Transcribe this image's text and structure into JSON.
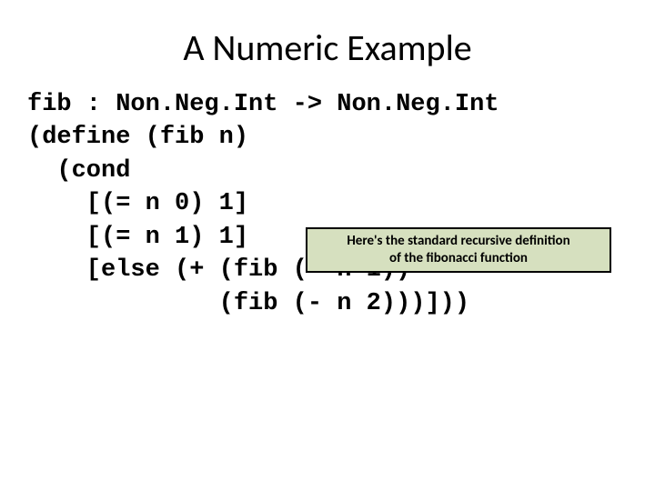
{
  "title": "A Numeric Example",
  "code": {
    "l1": "fib : Non.Neg.Int -> Non.Neg.Int",
    "l2": "(define (fib n)",
    "l3": "  (cond",
    "l4": "    [(= n 0) 1]",
    "l5": "    [(= n 1) 1]",
    "l6": "    [else (+ (fib (- n 1))",
    "l7": "             (fib (- n 2)))]))"
  },
  "callout": {
    "line1": "Here's the standard recursive definition",
    "line2": "of the fibonacci function"
  }
}
